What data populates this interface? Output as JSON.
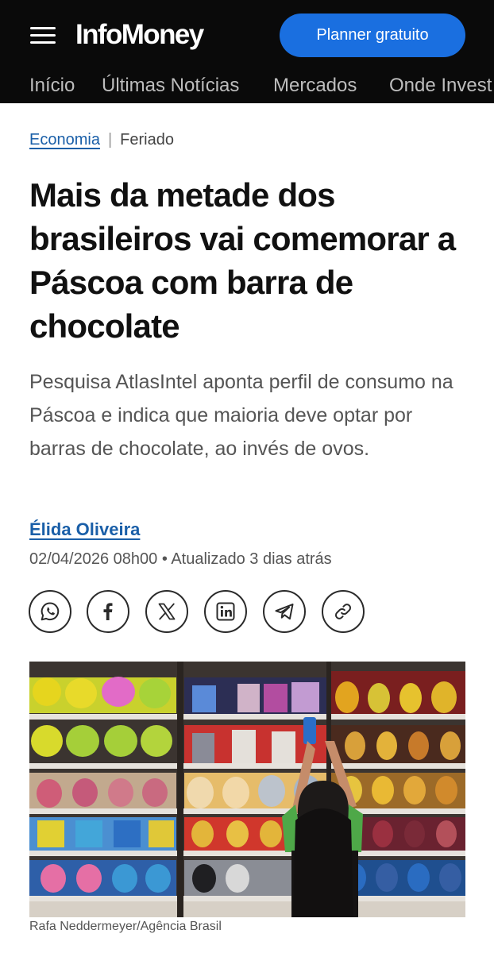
{
  "header": {
    "logo": "InfoMoney",
    "cta_label": "Planner gratuito",
    "nav": [
      "Início",
      "Últimas Notícias",
      "Mercados",
      "Onde Invest"
    ]
  },
  "article": {
    "category": "Economia",
    "tag": "Feriado",
    "title": "Mais da metade dos brasileiros vai comemorar a Páscoa com barra de chocolate",
    "subtitle": "Pesquisa AtlasIntel aponta perfil de consumo na Páscoa e indica que maioria deve optar por barras de chocolate, ao invés de ovos.",
    "author": "Élida Oliveira",
    "date": "02/04/2026 08h00",
    "separator": "•",
    "updated": "Atualizado 3 dias atrás",
    "photo_caption": "Rafa Neddermeyer/Agência Brasil"
  },
  "share": [
    "whatsapp-icon",
    "facebook-icon",
    "x-icon",
    "linkedin-icon",
    "telegram-icon",
    "link-icon"
  ],
  "colors": {
    "header_bg": "#0a0a0a",
    "accent_blue": "#1a6fe0",
    "link_blue": "#1a5fa8"
  }
}
